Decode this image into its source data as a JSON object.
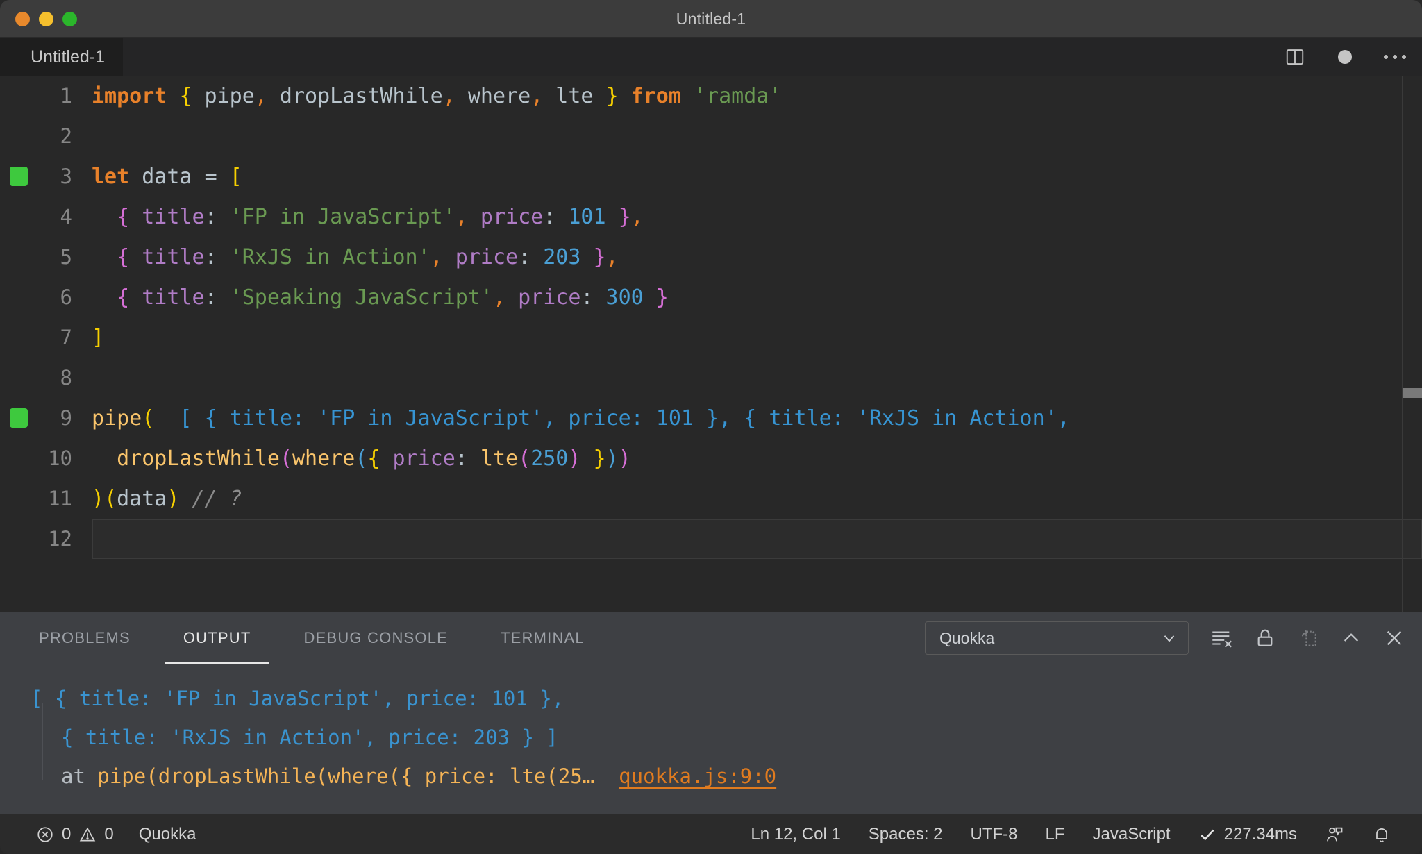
{
  "window": {
    "title": "Untitled-1",
    "traffic_lights": [
      "close-button",
      "minimize-button",
      "maximize-button"
    ]
  },
  "editor": {
    "tab_label": "Untitled-1",
    "actions": [
      "split-editor-icon",
      "unsaved-indicator-dot",
      "more-actions-icon"
    ],
    "lines": [
      {
        "no": "1",
        "breakpoint": false,
        "indent_guide": false,
        "current": false,
        "tokens": [
          {
            "t": "import",
            "c": "c-kw"
          },
          {
            "t": " ",
            "c": "c-plain"
          },
          {
            "t": "{",
            "c": "c-brc"
          },
          {
            "t": " pipe",
            "c": "c-plain"
          },
          {
            "t": ",",
            "c": "c-punc"
          },
          {
            "t": " dropLastWhile",
            "c": "c-plain"
          },
          {
            "t": ",",
            "c": "c-punc"
          },
          {
            "t": " where",
            "c": "c-plain"
          },
          {
            "t": ",",
            "c": "c-punc"
          },
          {
            "t": " lte ",
            "c": "c-plain"
          },
          {
            "t": "}",
            "c": "c-brc"
          },
          {
            "t": " ",
            "c": "c-plain"
          },
          {
            "t": "from",
            "c": "c-kw"
          },
          {
            "t": " ",
            "c": "c-plain"
          },
          {
            "t": "'ramda'",
            "c": "c-str"
          }
        ]
      },
      {
        "no": "2",
        "breakpoint": false,
        "indent_guide": false,
        "current": false,
        "tokens": []
      },
      {
        "no": "3",
        "breakpoint": true,
        "indent_guide": false,
        "current": false,
        "tokens": [
          {
            "t": "let",
            "c": "c-kw"
          },
          {
            "t": " data ",
            "c": "c-plain"
          },
          {
            "t": "=",
            "c": "c-plain"
          },
          {
            "t": " ",
            "c": "c-plain"
          },
          {
            "t": "[",
            "c": "c-brc"
          }
        ]
      },
      {
        "no": "4",
        "breakpoint": false,
        "indent_guide": true,
        "current": false,
        "tokens": [
          {
            "t": "  ",
            "c": "c-plain"
          },
          {
            "t": "{",
            "c": "c-brc2"
          },
          {
            "t": " ",
            "c": "c-plain"
          },
          {
            "t": "title",
            "c": "c-prop"
          },
          {
            "t": ":",
            "c": "c-plain"
          },
          {
            "t": " ",
            "c": "c-plain"
          },
          {
            "t": "'FP in JavaScript'",
            "c": "c-str"
          },
          {
            "t": ",",
            "c": "c-punc"
          },
          {
            "t": " ",
            "c": "c-plain"
          },
          {
            "t": "price",
            "c": "c-prop"
          },
          {
            "t": ":",
            "c": "c-plain"
          },
          {
            "t": " ",
            "c": "c-plain"
          },
          {
            "t": "101",
            "c": "c-num"
          },
          {
            "t": " ",
            "c": "c-plain"
          },
          {
            "t": "}",
            "c": "c-brc2"
          },
          {
            "t": ",",
            "c": "c-punc"
          }
        ]
      },
      {
        "no": "5",
        "breakpoint": false,
        "indent_guide": true,
        "current": false,
        "tokens": [
          {
            "t": "  ",
            "c": "c-plain"
          },
          {
            "t": "{",
            "c": "c-brc2"
          },
          {
            "t": " ",
            "c": "c-plain"
          },
          {
            "t": "title",
            "c": "c-prop"
          },
          {
            "t": ":",
            "c": "c-plain"
          },
          {
            "t": " ",
            "c": "c-plain"
          },
          {
            "t": "'RxJS in Action'",
            "c": "c-str"
          },
          {
            "t": ",",
            "c": "c-punc"
          },
          {
            "t": " ",
            "c": "c-plain"
          },
          {
            "t": "price",
            "c": "c-prop"
          },
          {
            "t": ":",
            "c": "c-plain"
          },
          {
            "t": " ",
            "c": "c-plain"
          },
          {
            "t": "203",
            "c": "c-num"
          },
          {
            "t": " ",
            "c": "c-plain"
          },
          {
            "t": "}",
            "c": "c-brc2"
          },
          {
            "t": ",",
            "c": "c-punc"
          }
        ]
      },
      {
        "no": "6",
        "breakpoint": false,
        "indent_guide": true,
        "current": false,
        "tokens": [
          {
            "t": "  ",
            "c": "c-plain"
          },
          {
            "t": "{",
            "c": "c-brc2"
          },
          {
            "t": " ",
            "c": "c-plain"
          },
          {
            "t": "title",
            "c": "c-prop"
          },
          {
            "t": ":",
            "c": "c-plain"
          },
          {
            "t": " ",
            "c": "c-plain"
          },
          {
            "t": "'Speaking JavaScript'",
            "c": "c-str"
          },
          {
            "t": ",",
            "c": "c-punc"
          },
          {
            "t": " ",
            "c": "c-plain"
          },
          {
            "t": "price",
            "c": "c-prop"
          },
          {
            "t": ":",
            "c": "c-plain"
          },
          {
            "t": " ",
            "c": "c-plain"
          },
          {
            "t": "300",
            "c": "c-num"
          },
          {
            "t": " ",
            "c": "c-plain"
          },
          {
            "t": "}",
            "c": "c-brc2"
          }
        ]
      },
      {
        "no": "7",
        "breakpoint": false,
        "indent_guide": false,
        "current": false,
        "tokens": [
          {
            "t": "]",
            "c": "c-brc"
          }
        ]
      },
      {
        "no": "8",
        "breakpoint": false,
        "indent_guide": false,
        "current": false,
        "tokens": []
      },
      {
        "no": "9",
        "breakpoint": true,
        "indent_guide": false,
        "current": false,
        "tokens": [
          {
            "t": "pipe",
            "c": "c-fn"
          },
          {
            "t": "(",
            "c": "c-brc"
          },
          {
            "t": "  [ { title: 'FP in JavaScript', price: 101 }, { title: 'RxJS in Action',",
            "c": "c-inline"
          }
        ]
      },
      {
        "no": "10",
        "breakpoint": false,
        "indent_guide": true,
        "current": false,
        "tokens": [
          {
            "t": "  ",
            "c": "c-plain"
          },
          {
            "t": "dropLastWhile",
            "c": "c-fn"
          },
          {
            "t": "(",
            "c": "c-brc2"
          },
          {
            "t": "where",
            "c": "c-fn"
          },
          {
            "t": "(",
            "c": "c-num"
          },
          {
            "t": "{",
            "c": "c-brc"
          },
          {
            "t": " ",
            "c": "c-plain"
          },
          {
            "t": "price",
            "c": "c-prop"
          },
          {
            "t": ":",
            "c": "c-plain"
          },
          {
            "t": " ",
            "c": "c-plain"
          },
          {
            "t": "lte",
            "c": "c-fn"
          },
          {
            "t": "(",
            "c": "c-brc2"
          },
          {
            "t": "250",
            "c": "c-num"
          },
          {
            "t": ")",
            "c": "c-brc2"
          },
          {
            "t": " ",
            "c": "c-plain"
          },
          {
            "t": "}",
            "c": "c-brc"
          },
          {
            "t": ")",
            "c": "c-num"
          },
          {
            "t": ")",
            "c": "c-brc2"
          }
        ]
      },
      {
        "no": "11",
        "breakpoint": false,
        "indent_guide": false,
        "current": false,
        "tokens": [
          {
            "t": ")",
            "c": "c-brc"
          },
          {
            "t": "(",
            "c": "c-brc"
          },
          {
            "t": "data",
            "c": "c-plain"
          },
          {
            "t": ")",
            "c": "c-brc"
          },
          {
            "t": " ",
            "c": "c-plain"
          },
          {
            "t": "// ?",
            "c": "c-com"
          }
        ]
      },
      {
        "no": "12",
        "breakpoint": false,
        "indent_guide": false,
        "current": true,
        "tokens": []
      }
    ]
  },
  "panel": {
    "tabs": [
      {
        "label": "PROBLEMS",
        "active": false
      },
      {
        "label": "OUTPUT",
        "active": true
      },
      {
        "label": "DEBUG CONSOLE",
        "active": false
      },
      {
        "label": "TERMINAL",
        "active": false
      }
    ],
    "channel_select": {
      "value": "Quokka",
      "chevron": "chevron-down-icon"
    },
    "actions": [
      "clear-output-icon",
      "turn-auto-scrolling-off-icon",
      "open-output-in-editor-icon",
      "maximize-panel-icon",
      "close-panel-icon"
    ],
    "output": [
      {
        "indent": 0,
        "parts": [
          {
            "t": "[ { title: 'FP in JavaScript', price: 101 },",
            "c": "o-blue"
          }
        ]
      },
      {
        "indent": 1,
        "parts": [
          {
            "t": "{ title: 'RxJS in Action', price: 203 } ]",
            "c": "o-blue"
          }
        ]
      },
      {
        "indent": 1,
        "parts": [
          {
            "t": "at ",
            "c": "o-grey"
          },
          {
            "t": "pipe(dropLastWhile(where({ price: lte(25…  ",
            "c": "o-amber"
          },
          {
            "t": "quokka.js:9:0",
            "c": "o-link"
          }
        ]
      }
    ]
  },
  "statusbar": {
    "errors_icon": "error-circle-icon",
    "errors": "0",
    "warnings_icon": "warning-triangle-icon",
    "warnings": "0",
    "extension": "Quokka",
    "cursor": "Ln 12, Col 1",
    "indentation": "Spaces: 2",
    "encoding": "UTF-8",
    "eol": "LF",
    "language": "JavaScript",
    "run_status_icon": "check-icon",
    "run_time": "227.34ms",
    "feedback_icon": "feedback-person-icon",
    "bell_icon": "bell-icon"
  },
  "colors": {
    "accent_blue": "#3794d2",
    "keyword_orange": "#e8812a",
    "string_green": "#6a9a52",
    "number_blue": "#4a9fd4",
    "property_purple": "#b07cc6",
    "bracket_yellow": "#f7d000",
    "breakpoint_green": "#3ec93e",
    "link_orange": "#e07b1f"
  }
}
